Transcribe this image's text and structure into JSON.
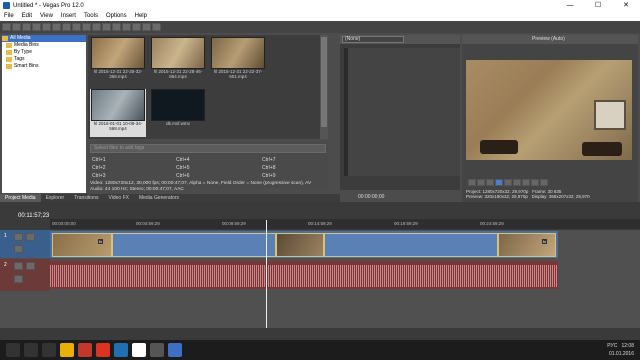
{
  "window": {
    "title": "Untitled * - Vegas Pro 12.0",
    "controls": [
      "—",
      "☐",
      "✕"
    ]
  },
  "menu": [
    "File",
    "Edit",
    "View",
    "Insert",
    "Tools",
    "Options",
    "Help"
  ],
  "tree": [
    "All Media",
    "Media Bins",
    "By Type",
    "Tags",
    "Smart Bins"
  ],
  "thumbs": [
    {
      "name": "hl 2015-12-31 22-35-32-368.mp4"
    },
    {
      "name": "hl 2015-12-31 22-28-46-864.mp4"
    },
    {
      "name": "hl 2015-12-31 22-22-37-601.mp4"
    },
    {
      "name": "hl 2016-01-01 10-08-34-568.mp4"
    },
    {
      "name": "dk.mxf.wmv"
    }
  ],
  "tag_search": "Select files to add tags",
  "tag_controls": [
    "Ctrl+1",
    "Ctrl+2",
    "Ctrl+3",
    "Ctrl+4",
    "Ctrl+5",
    "Ctrl+6",
    "Ctrl+7",
    "Ctrl+8",
    "Ctrl+9"
  ],
  "media_info": [
    "Video: 1280x720x12, 30,000 fps; 00:00:47;07, Alpha = None, Field Order = None (progressive scan), AV",
    "Audio: 44 100 Hz; Stereo; 00:00:47;07, AAC"
  ],
  "tabs": [
    "Project Media",
    "Explorer",
    "Transitions",
    "Video FX",
    "Media Generators"
  ],
  "mid": {
    "select": "(None)",
    "time": "00:00:00;00"
  },
  "preview": {
    "mode": "Preview (Auto)",
    "project_label": "Project:",
    "project_val": "1280x720x32; 29,970p",
    "preview_label": "Preview:",
    "preview_val": "320x180x32; 29,970p",
    "frame_label": "Frame:",
    "frame_val": "30 835",
    "display_label": "Display:",
    "display_val": "368x207x32; 29,970"
  },
  "timecode": "00:11:57;23",
  "ruler": [
    "00:00:00;00",
    "00:04:59;29",
    "00:09:59;29",
    "00:14:59;29",
    "00:19:59;29",
    "00:24:59;29"
  ],
  "track_numbers": [
    "1",
    "2"
  ],
  "clip_tags": [
    "fx",
    "fx"
  ],
  "clock": {
    "time": "12:08",
    "date": "01.01.2016",
    "lang": "РУС"
  },
  "colors": {
    "video_track": "#4a6fa3",
    "audio_track": "#7a3636",
    "accent": "#4a7bd6"
  }
}
